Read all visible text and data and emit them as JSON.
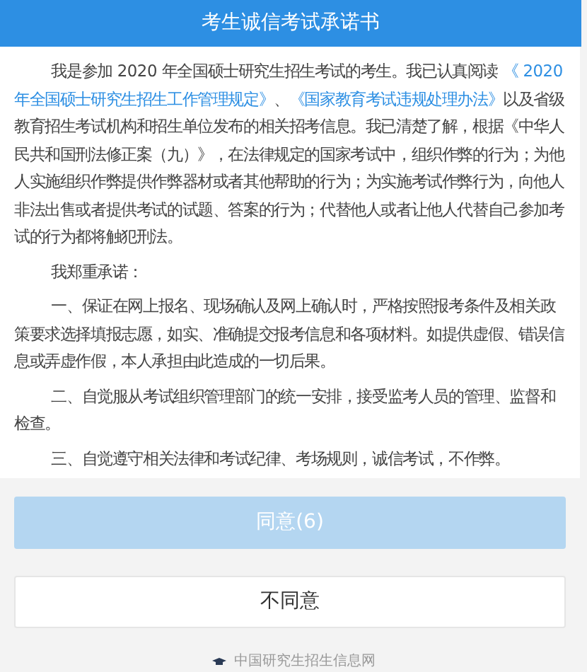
{
  "header": {
    "title": "考生诚信考试承诺书"
  },
  "paragraphs": [
    {
      "parts": [
        {
          "kind": "text",
          "text": "我是参加 2020 年全国硕士研究生招生考试的考生。我已认真阅读 "
        },
        {
          "kind": "link",
          "text": "《 2020年全国硕士研究生招生工作管理规定》"
        },
        {
          "kind": "text",
          "text": "、"
        },
        {
          "kind": "link",
          "text": "《国家教育考试违规处理办法》"
        },
        {
          "kind": "text",
          "text": "以及省级教育招生考试机构和招生单位发布的相关招考信息。我已清楚了解，根据《中华人民共和国刑法修正案（九）》，在法律规定的国家考试中，组织作弊的行为；为他人实施组织作弊提供作弊器材或者其他帮助的行为；为实施考试作弊行为，向他人非法出售或者提供考试的试题、答案的行为；代替他人或者让他人代替自己参加考试的行为都将触犯刑法。"
        }
      ]
    },
    {
      "parts": [
        {
          "kind": "text",
          "text": "我郑重承诺："
        }
      ]
    },
    {
      "parts": [
        {
          "kind": "text",
          "text": "一、保证在网上报名、现场确认及网上确认时，严格按照报考条件及相关政策要求选择填报志愿，如实、准确提交报考信息和各项材料。如提供虚假、错误信息或弄虚作假，本人承担由此造成的一切后果。"
        }
      ]
    },
    {
      "parts": [
        {
          "kind": "text",
          "text": "二、自觉服从考试组织管理部门的统一安排，接受监考人员的管理、监督和检查。"
        }
      ]
    },
    {
      "parts": [
        {
          "kind": "text",
          "text": "三、自觉遵守相关法律和考试纪律、考场规则，诚信考试，不作弊。"
        }
      ]
    }
  ],
  "buttons": [
    {
      "label": "同意(6)",
      "kind": "primary",
      "disabled": true
    },
    {
      "label": "不同意",
      "kind": "default",
      "disabled": false
    }
  ],
  "footer": {
    "text": "中国研究生招生信息网"
  }
}
